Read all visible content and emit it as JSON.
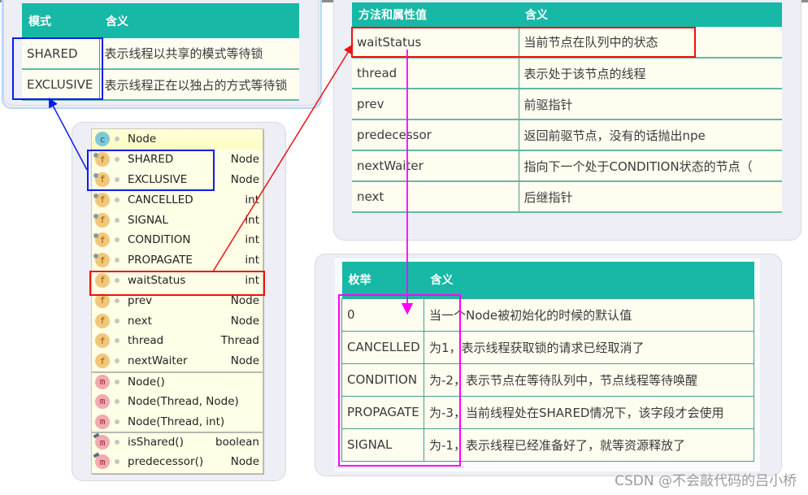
{
  "mode_table": {
    "headers": [
      "模式",
      "含义"
    ],
    "rows": [
      [
        "SHARED",
        "表示线程以共享的模式等待锁"
      ],
      [
        "EXCLUSIVE",
        "表示线程正在以独占的方式等待锁"
      ]
    ]
  },
  "attr_table": {
    "headers": [
      "方法和属性值",
      "含义"
    ],
    "rows": [
      [
        "waitStatus",
        "当前节点在队列中的状态"
      ],
      [
        "thread",
        "表示处于该节点的线程"
      ],
      [
        "prev",
        "前驱指针"
      ],
      [
        "predecessor",
        "返回前驱节点，没有的话抛出npe"
      ],
      [
        "nextWaiter",
        "指向下一个处于CONDITION状态的节点（"
      ],
      [
        "next",
        "后继指针"
      ]
    ]
  },
  "enum_table": {
    "headers": [
      "枚举",
      "含义"
    ],
    "rows": [
      [
        "0",
        "当一个Node被初始化的时候的默认值"
      ],
      [
        "CANCELLED",
        "为1，表示线程获取锁的请求已经取消了"
      ],
      [
        "CONDITION",
        "为-2，表示节点在等待队列中，节点线程等待唤醒"
      ],
      [
        "PROPAGATE",
        "为-3，当前线程处在SHARED情况下，该字段才会使用"
      ],
      [
        "SIGNAL",
        "为-1，表示线程已经准备好了，就等资源释放了"
      ]
    ]
  },
  "structure": {
    "class_name": "Node",
    "class_icon": "class-icon",
    "members": [
      {
        "name": "SHARED",
        "type": "Node",
        "icon": "static-field-icon",
        "kind": "sf"
      },
      {
        "name": "EXCLUSIVE",
        "type": "Node",
        "icon": "static-field-icon",
        "kind": "sf"
      },
      {
        "name": "CANCELLED",
        "type": "int",
        "icon": "static-field-icon",
        "kind": "sf"
      },
      {
        "name": "SIGNAL",
        "type": "int",
        "icon": "static-field-icon",
        "kind": "sf"
      },
      {
        "name": "CONDITION",
        "type": "int",
        "icon": "static-field-icon",
        "kind": "sf"
      },
      {
        "name": "PROPAGATE",
        "type": "int",
        "icon": "static-field-icon",
        "kind": "sf"
      },
      {
        "name": "waitStatus",
        "type": "int",
        "icon": "field-icon",
        "kind": "f"
      },
      {
        "name": "prev",
        "type": "Node",
        "icon": "field-icon",
        "kind": "f"
      },
      {
        "name": "next",
        "type": "Node",
        "icon": "field-icon",
        "kind": "f"
      },
      {
        "name": "thread",
        "type": "Thread",
        "icon": "field-icon",
        "kind": "f"
      },
      {
        "name": "nextWaiter",
        "type": "Node",
        "icon": "field-icon",
        "kind": "f"
      },
      {
        "name": "Node()",
        "type": "",
        "icon": "method-icon",
        "kind": "m"
      },
      {
        "name": "Node(Thread, Node)",
        "type": "",
        "icon": "method-icon",
        "kind": "m"
      },
      {
        "name": "Node(Thread, int)",
        "type": "",
        "icon": "method-icon",
        "kind": "m"
      },
      {
        "name": "isShared()",
        "type": "boolean",
        "icon": "final-method-icon",
        "kind": "am"
      },
      {
        "name": "predecessor()",
        "type": "Node",
        "icon": "final-method-icon",
        "kind": "am"
      }
    ],
    "icon_letters": {
      "c": "c",
      "sf": "f",
      "f": "f",
      "m": "m",
      "am": "m"
    }
  },
  "annotation_colors": {
    "blue": "#0b1cf0",
    "red": "#ee1111",
    "magenta": "#ff00ff",
    "header": "#17b8a6"
  },
  "watermark": "CSDN @不会敲代码的吕小桥"
}
